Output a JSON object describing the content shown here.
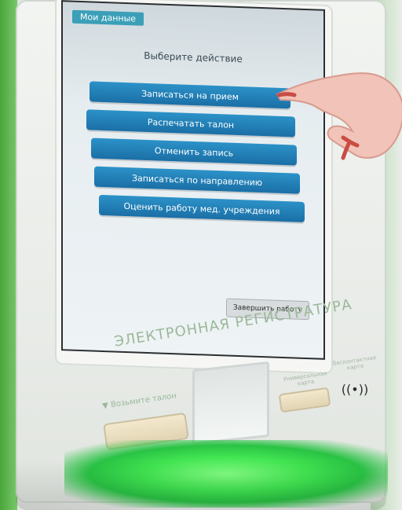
{
  "kiosk": {
    "my_data_button": "Мои данные",
    "prompt": "Выберите действие",
    "actions": [
      "Записаться на прием",
      "Распечатать талон",
      "Отменить запись",
      "Записаться по направлению",
      "Оценить работу мед. учреждения"
    ],
    "finish_button": "Завершить работу",
    "brand": "ЭЛЕКТРОННАЯ РЕГИСТРАТУРА",
    "ticket_label": "▼ Возьмите талон",
    "card_label": "Универсальная карта",
    "contactless_label": "Бесконтактная карта",
    "contactless_symbol": "((•))"
  },
  "colors": {
    "accent_button": "#1a6fa6",
    "brand_text": "#9bb89a",
    "led": "#39e54a"
  },
  "icons": {
    "contactless": "contactless-icon"
  }
}
